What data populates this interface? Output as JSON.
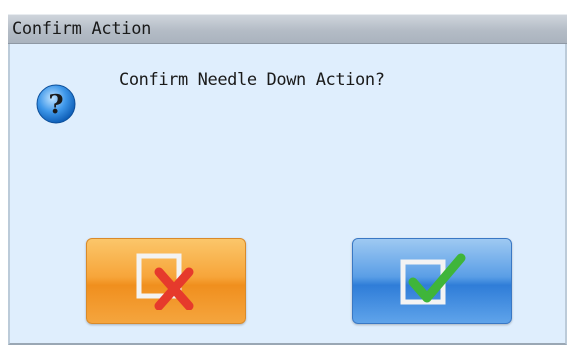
{
  "dialog": {
    "title": "Confirm Action",
    "message": "Confirm Needle Down Action?",
    "icon": "question-icon"
  },
  "buttons": {
    "cancel": {
      "icon": "cancel-x-icon"
    },
    "ok": {
      "icon": "check-icon"
    }
  },
  "colors": {
    "titlebar": "#b4bcc6",
    "body": "#dfeefd",
    "cancel_button": "#f7a53a",
    "ok_button": "#3f8ce0",
    "x_mark": "#e63a2c",
    "check_mark": "#3fb53a"
  }
}
